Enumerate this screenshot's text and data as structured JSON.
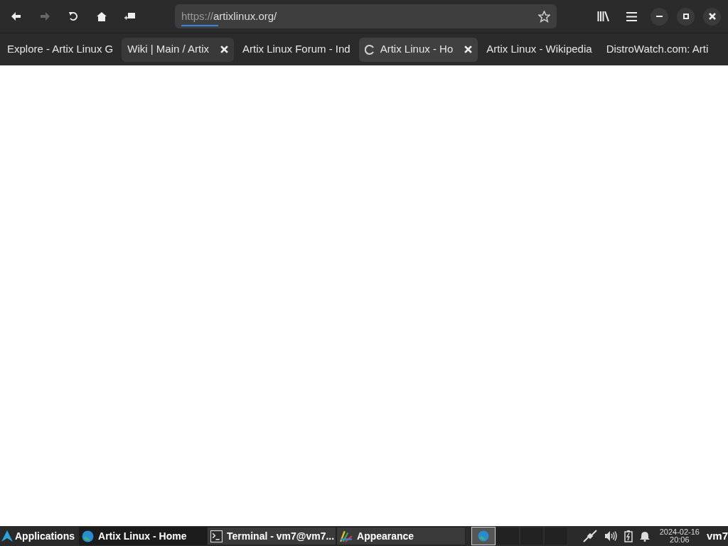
{
  "toolbar": {
    "url_scheme": "https://",
    "url_host": "artixlinux.org/"
  },
  "tabs": [
    {
      "label": "Explore - Artix Linux G",
      "selected": false,
      "hovered": false,
      "loading": false
    },
    {
      "label": "Wiki | Main / Artix",
      "selected": false,
      "hovered": true,
      "loading": false
    },
    {
      "label": "Artix Linux Forum - Ind",
      "selected": false,
      "hovered": false,
      "loading": false
    },
    {
      "label": "Artix Linux - Ho",
      "selected": true,
      "hovered": false,
      "loading": true
    },
    {
      "label": "Artix Linux - Wikipedia",
      "selected": false,
      "hovered": false,
      "loading": false
    },
    {
      "label": "DistroWatch.com: Arti",
      "selected": false,
      "hovered": false,
      "loading": false
    }
  ],
  "taskbar": {
    "menu_label": "Applications",
    "windows": [
      {
        "label": "Artix Linux - Home",
        "kind": "browser",
        "selected": true
      },
      {
        "label": "Terminal - vm7@vm7...",
        "kind": "terminal",
        "selected": false
      },
      {
        "label": "Appearance",
        "kind": "appearance",
        "selected": false
      }
    ],
    "workspaces": [
      {
        "selected": true,
        "has_window": true
      },
      {
        "selected": false,
        "has_window": false
      },
      {
        "selected": false,
        "has_window": false
      },
      {
        "selected": false,
        "has_window": false
      }
    ],
    "date": "2024-02-16",
    "time": "20:06",
    "user": "vm7"
  }
}
